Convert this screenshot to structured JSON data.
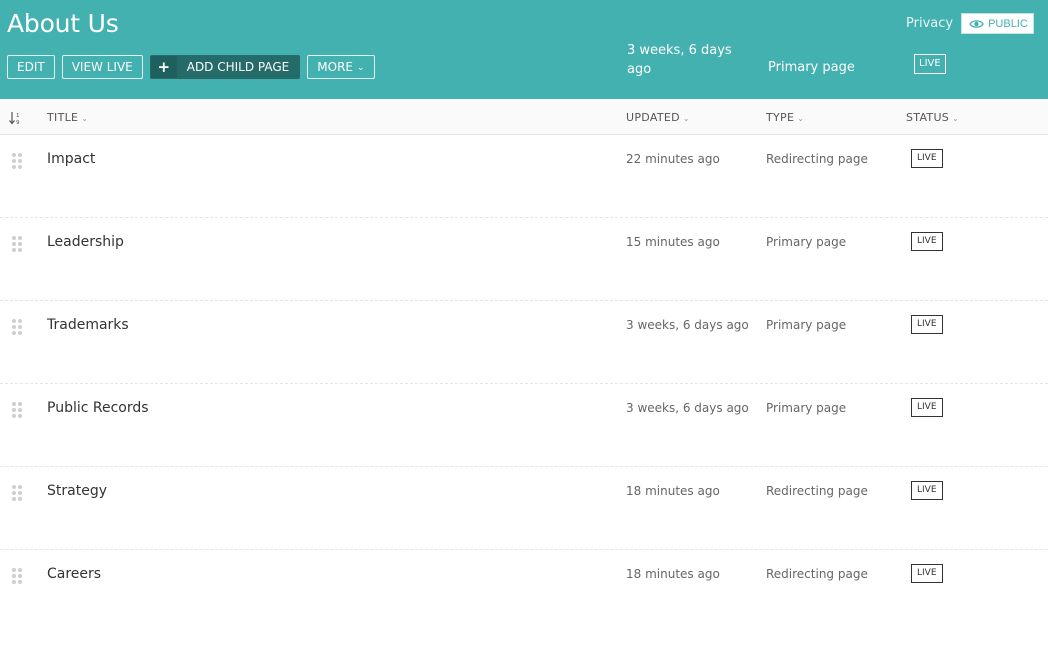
{
  "header": {
    "title": "About Us",
    "buttons": {
      "edit": "Edit",
      "view_live": "View live",
      "add_child": "Add child page",
      "more": "More"
    },
    "updated": "3 weeks, 6 days ago",
    "type": "Primary page",
    "status": "LIVE",
    "privacy_label": "Privacy",
    "privacy_value": "PUBLIC"
  },
  "columns": {
    "title": "Title",
    "updated": "Updated",
    "type": "Type",
    "status": "Status"
  },
  "rows": [
    {
      "title": "Impact",
      "updated": "22 minutes ago",
      "type": "Redirecting page",
      "status": "LIVE"
    },
    {
      "title": "Leadership",
      "updated": "15 minutes ago",
      "type": "Primary page",
      "status": "LIVE"
    },
    {
      "title": "Trademarks",
      "updated": "3 weeks, 6 days ago",
      "type": "Primary page",
      "status": "LIVE"
    },
    {
      "title": "Public Records",
      "updated": "3 weeks, 6 days ago",
      "type": "Primary page",
      "status": "LIVE"
    },
    {
      "title": "Strategy",
      "updated": "18 minutes ago",
      "type": "Redirecting page",
      "status": "LIVE"
    },
    {
      "title": "Careers",
      "updated": "18 minutes ago",
      "type": "Redirecting page",
      "status": "LIVE"
    }
  ],
  "colors": {
    "header_bg": "#43b1b0",
    "primary_button": "#246b6a"
  }
}
